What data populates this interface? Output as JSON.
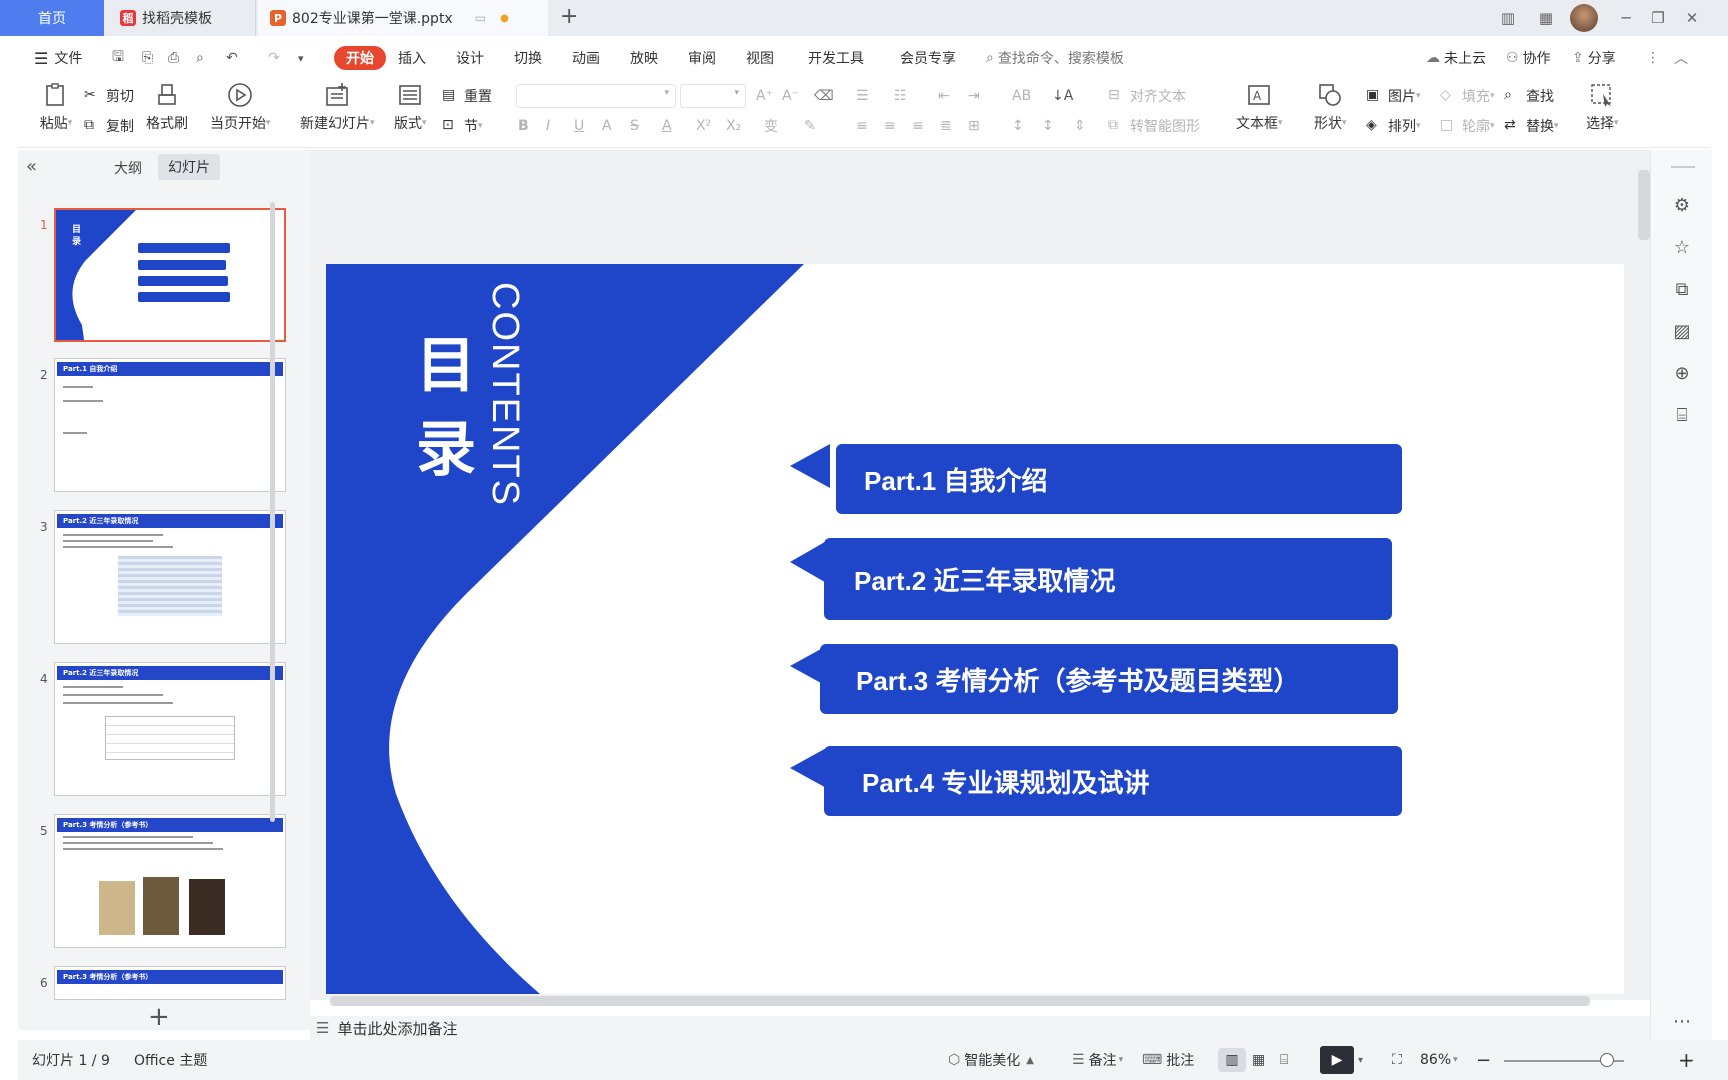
{
  "tabs": {
    "home": "首页",
    "template_tab": "找稻壳模板",
    "doc_tab": "802专业课第一堂课.pptx",
    "add_tab": "+"
  },
  "menu": {
    "file": "文件",
    "start": "开始",
    "insert": "插入",
    "design": "设计",
    "transition": "切换",
    "animation": "动画",
    "slideshow": "放映",
    "review": "审阅",
    "view": "视图",
    "developer": "开发工具",
    "member": "会员专享",
    "search_placeholder": "查找命令、搜索模板",
    "cloud": "未上云",
    "collab": "协作",
    "share": "分享"
  },
  "ribbon": {
    "paste": "粘贴",
    "cut": "剪切",
    "copy": "复制",
    "format_painter": "格式刷",
    "from_current": "当页开始",
    "new_slide": "新建幻灯片",
    "layout": "版式",
    "reset": "重置",
    "section": "节",
    "align_text": "对齐文本",
    "smart_shape": "转智能图形",
    "textbox": "文本框",
    "shape": "形状",
    "picture": "图片",
    "arrange": "排列",
    "fill": "填充",
    "outline": "轮廓",
    "find": "查找",
    "replace": "替换",
    "select": "选择"
  },
  "left_panel": {
    "outline_tab": "大纲",
    "slides_tab": "幻灯片",
    "thumbnails": [
      {
        "num": "1",
        "title": ""
      },
      {
        "num": "2",
        "title": "Part.1 自我介绍"
      },
      {
        "num": "3",
        "title": "Part.2 近三年录取情况"
      },
      {
        "num": "4",
        "title": "Part.2 近三年录取情况"
      },
      {
        "num": "5",
        "title": "Part.3 考情分析（参考书）"
      },
      {
        "num": "6",
        "title": "Part.3 考情分析（参考书）"
      }
    ],
    "add": "+"
  },
  "slide": {
    "title": "目录",
    "title_char1": "目",
    "title_char2": "录",
    "subtitle": "CONTENTS",
    "parts": [
      {
        "label": "Part.1 自我介绍"
      },
      {
        "label": "Part.2  近三年录取情况"
      },
      {
        "label": "Part.3  考情分析（参考书及题目类型）"
      },
      {
        "label": "Part.4 专业课规划及试讲"
      }
    ],
    "accent_color": "#1f45c9"
  },
  "notes": {
    "placeholder": "单击此处添加备注"
  },
  "status": {
    "slide_counter": "幻灯片 1 / 9",
    "theme": "Office 主题",
    "beautify": "智能美化",
    "notes": "备注",
    "comment": "批注",
    "zoom": "86%",
    "zoom_level": 0.86
  }
}
